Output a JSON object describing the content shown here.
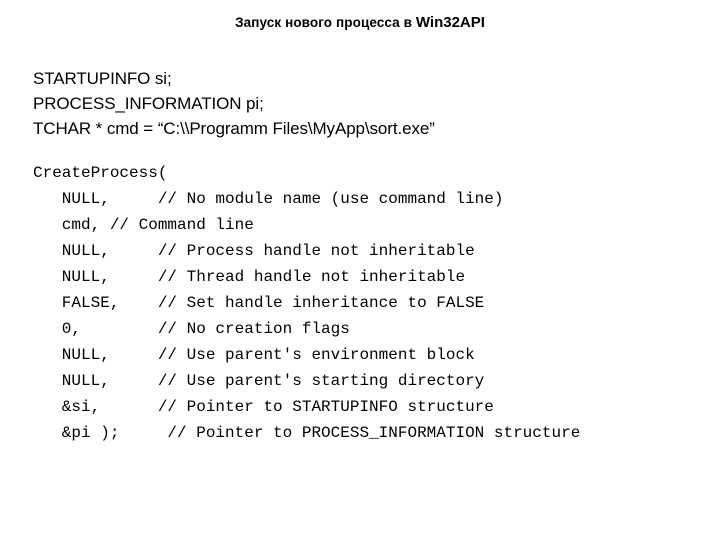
{
  "slide": {
    "title_prefix": "Запуск нового процесса в ",
    "title_api": "Win32API",
    "background_color": "#ffffff",
    "text_color": "#000000"
  },
  "declarations": {
    "lines": [
      "STARTUPINFO si;",
      "PROCESS_INFORMATION pi;",
      "TCHAR * cmd = “C:\\\\Programm Files\\MyApp\\sort.exe”"
    ]
  },
  "code": {
    "lines": [
      "CreateProcess(",
      "   NULL,     // No module name (use command line)",
      "   cmd, // Command line",
      "   NULL,     // Process handle not inheritable",
      "   NULL,     // Thread handle not inheritable",
      "   FALSE,    // Set handle inheritance to FALSE",
      "   0,        // No creation flags",
      "   NULL,     // Use parent's environment block",
      "   NULL,     // Use parent's starting directory",
      "   &si,      // Pointer to STARTUPINFO structure",
      "   &pi );     // Pointer to PROCESS_INFORMATION structure"
    ]
  }
}
